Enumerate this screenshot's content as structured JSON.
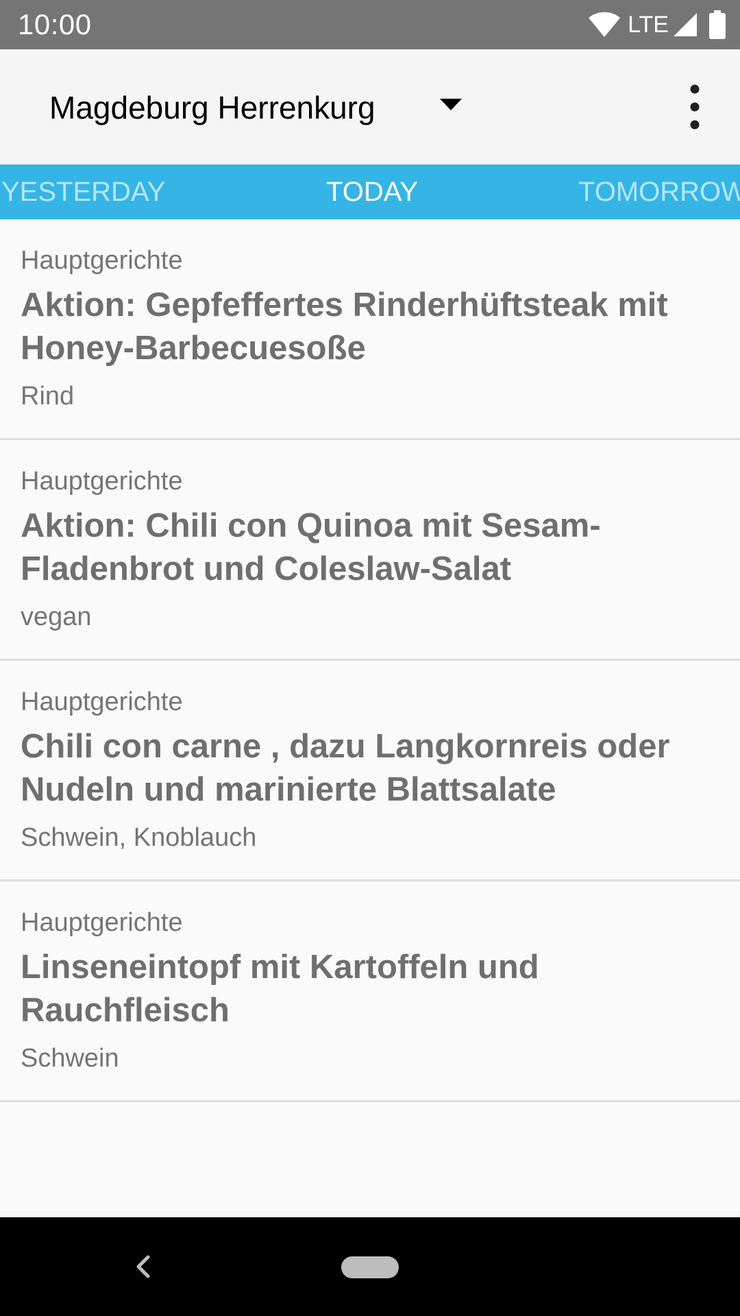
{
  "status_bar": {
    "time": "10:00",
    "network": "LTE",
    "icons": [
      "wifi-icon",
      "cell-signal-icon",
      "battery-icon"
    ]
  },
  "app_bar": {
    "location": "Magdeburg Herrenkurg",
    "dropdown_icon": "arrow-drop-down-icon",
    "overflow_icon": "more-vert-icon"
  },
  "tabs": [
    {
      "label": "YESTERDAY",
      "selected": false
    },
    {
      "label": "TODAY",
      "selected": true
    },
    {
      "label": "TOMORROW",
      "selected": false
    }
  ],
  "meals": [
    {
      "category": "Hauptgerichte",
      "name": "Aktion: Gepfeffertes Rinderhüftsteak mit Honey-Barbecuesoße",
      "tags": "Rind"
    },
    {
      "category": "Hauptgerichte",
      "name": "Aktion: Chili con Quinoa mit Sesam-Fladenbrot und Coleslaw-Salat",
      "tags": "vegan"
    },
    {
      "category": "Hauptgerichte",
      "name": "Chili con carne , dazu Langkornreis oder Nudeln und marinierte Blattsalate",
      "tags": "Schwein, Knoblauch"
    },
    {
      "category": "Hauptgerichte",
      "name": "Linseneintopf mit Kartoffeln und Rauchfleisch",
      "tags": "Schwein"
    }
  ],
  "colors": {
    "status_bar": "#757575",
    "app_bar": "#f5f5f5",
    "tab_bar": "#35b5e5",
    "tab_active_text": "#ffffff",
    "tab_inactive_text": "#b6e6f8",
    "list_background": "#fafafa",
    "meal_text": "#6f6f6f",
    "nav_bar": "#000000"
  }
}
